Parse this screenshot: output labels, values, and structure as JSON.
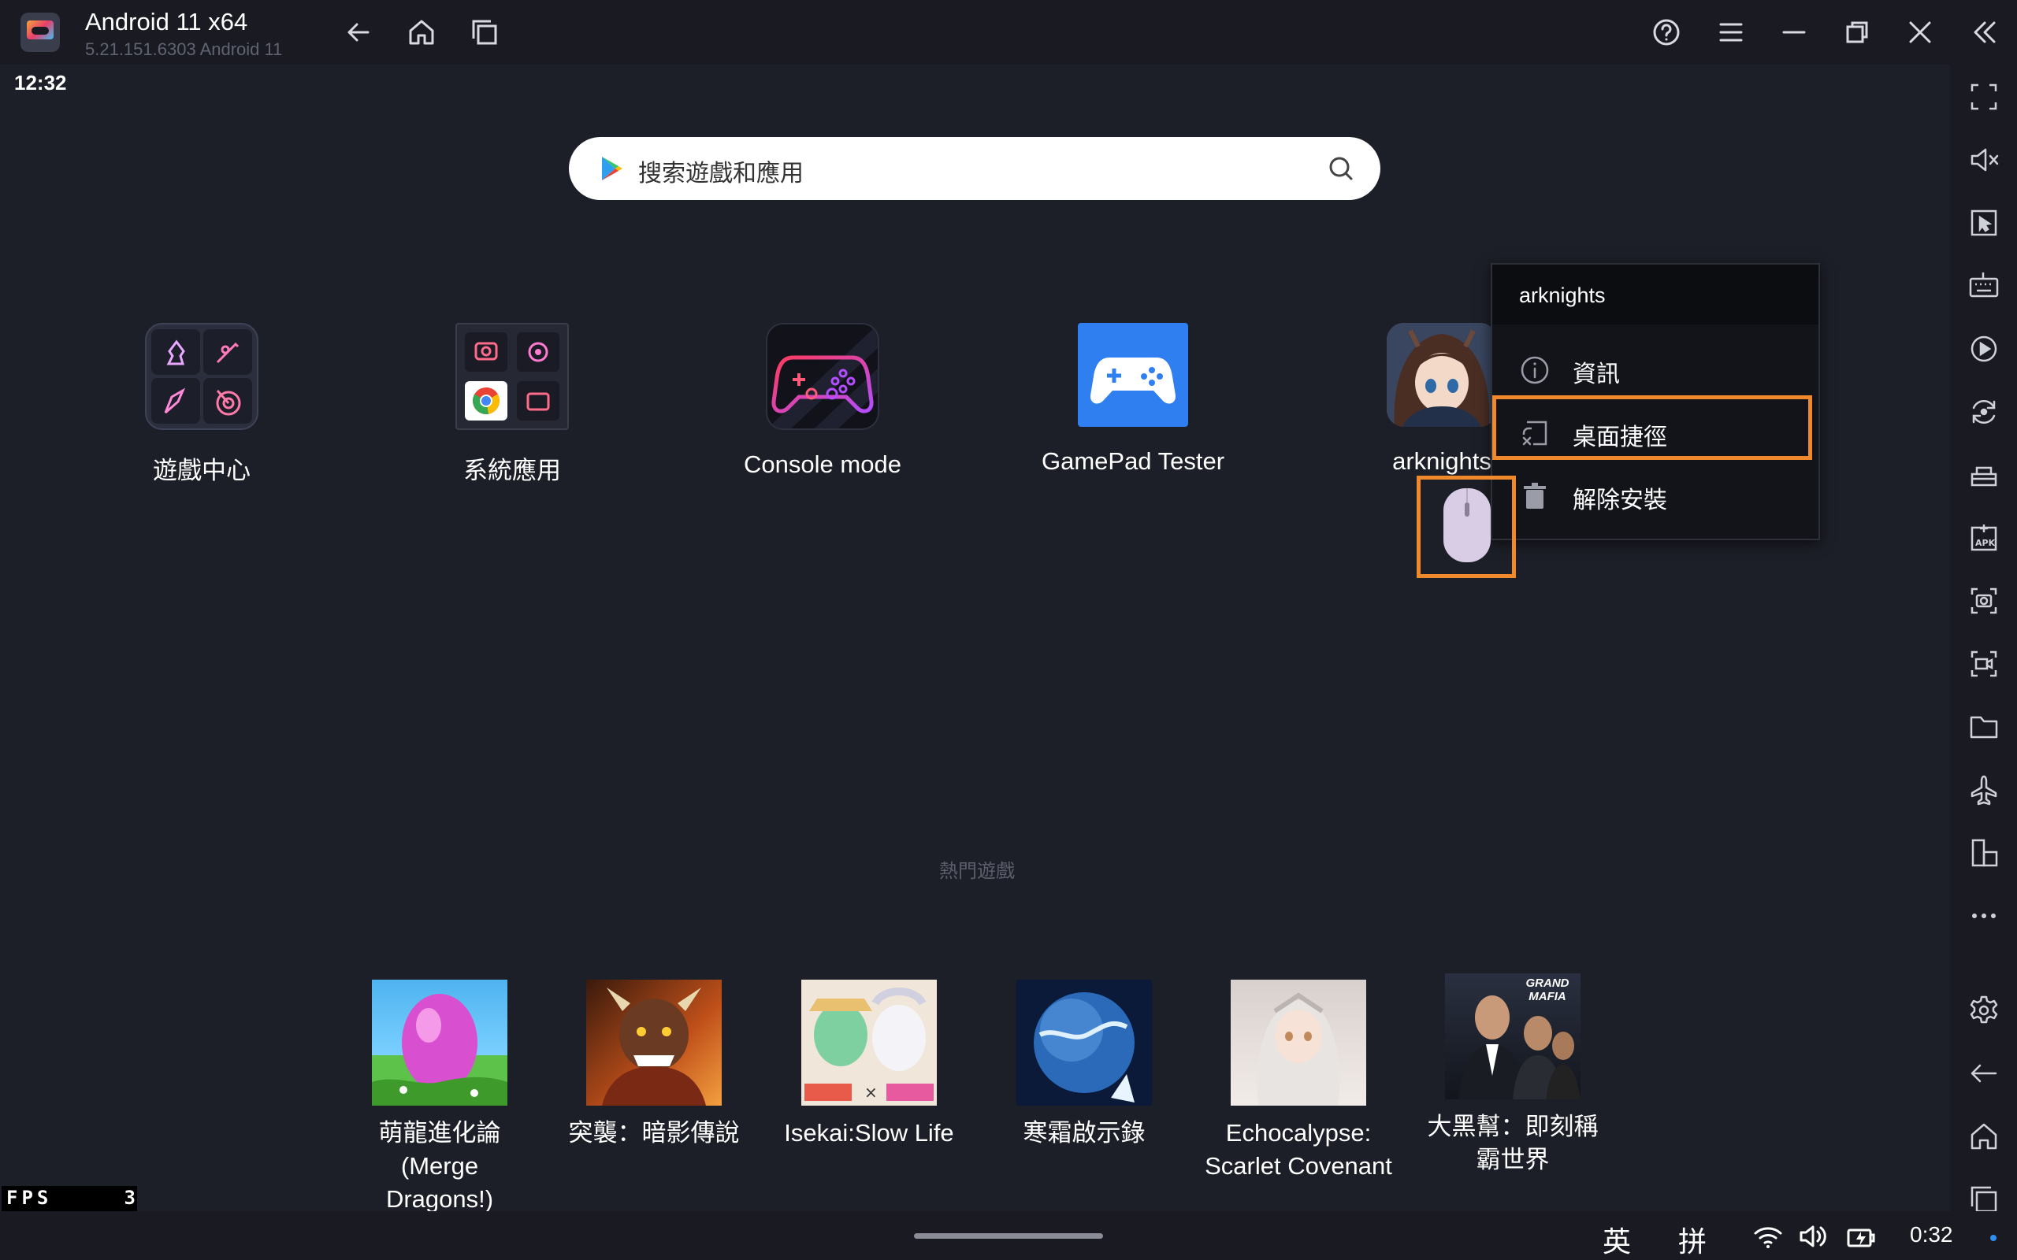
{
  "window": {
    "title": "Android 11 x64",
    "subtitle": "5.21.151.6303  Android 11"
  },
  "titlebar_icons": [
    "back-arrow-icon",
    "home-icon",
    "recent-apps-icon",
    "help-icon",
    "menu-icon",
    "minimize-icon",
    "restore-icon",
    "close-icon",
    "collapse-sidebar-icon"
  ],
  "status": {
    "time": "12:32"
  },
  "search": {
    "placeholder": "搜索遊戲和應用"
  },
  "apps": [
    {
      "label": "遊戲中心"
    },
    {
      "label": "系統應用"
    },
    {
      "label": "Console mode"
    },
    {
      "label": "GamePad Tester"
    },
    {
      "label": "arknights"
    }
  ],
  "context_menu": {
    "title": "arknights",
    "items": [
      {
        "label": "資訊",
        "icon": "info-icon"
      },
      {
        "label": "桌面捷徑",
        "icon": "shortcut-icon"
      },
      {
        "label": "解除安裝",
        "icon": "trash-icon"
      }
    ]
  },
  "hot_games": {
    "title": "熱門遊戲",
    "items": [
      {
        "line1": "萌龍進化論",
        "line2": "(Merge Dragons!)"
      },
      {
        "line1": "突襲：暗影傳說",
        "line2": ""
      },
      {
        "line1": "Isekai:Slow Life",
        "line2": ""
      },
      {
        "line1": "寒霜啟示錄",
        "line2": ""
      },
      {
        "line1": "Echocalypse:",
        "line2": "Scarlet Covenant"
      },
      {
        "line1": "大黑幫：即刻稱",
        "line2": "霸世界",
        "badge": "GRAND MAFIA"
      }
    ]
  },
  "fps": {
    "label": "FPS",
    "value": "3"
  },
  "sidebar_icons": [
    "fullscreen-icon",
    "volume-mute-icon",
    "cursor-lock-icon",
    "keyboard-icon",
    "record-icon",
    "sync-icon",
    "toolbox-icon",
    "apk-icon",
    "screenshot-icon",
    "screen-record-icon",
    "folder-icon",
    "airplane-icon",
    "multi-window-icon",
    "more-icon",
    "settings-icon",
    "back-icon",
    "home-icon",
    "recent-apps-icon"
  ],
  "taskbar": {
    "ime_en": "英",
    "ime_pin": "拼",
    "time": "0:32",
    "tray_icons": [
      "wifi-icon",
      "speaker-icon",
      "battery-charging-icon"
    ]
  },
  "colors": {
    "highlight": "#f0892b",
    "background": "#1d1f28",
    "gamepad_blue": "#2f7ff0"
  }
}
